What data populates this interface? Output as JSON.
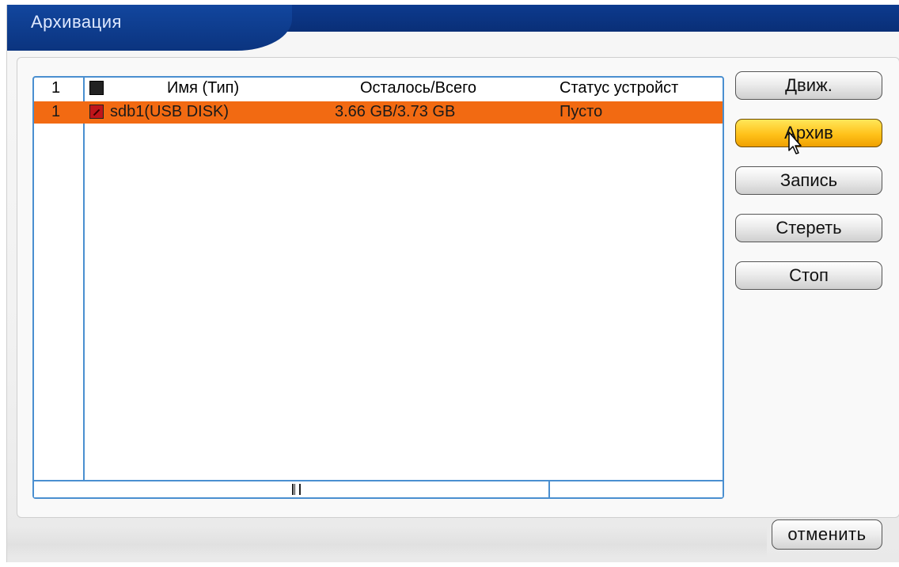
{
  "window": {
    "title": "Архивация"
  },
  "table": {
    "header": {
      "num": "1",
      "name": "Имя (Тип)",
      "size": "Осталось/Всего",
      "status": "Статус устройст"
    },
    "rows": [
      {
        "num": "1",
        "name": "sdb1(USB DISK)",
        "size": "3.66 GB/3.73 GB",
        "status": "Пусто",
        "selected": true
      }
    ]
  },
  "buttons": {
    "detect": "Движ.",
    "archive": "Архив",
    "record": "Запись",
    "erase": "Стереть",
    "stop": "Стоп",
    "cancel": "отменить"
  },
  "colors": {
    "title_bar": "#0b347f",
    "selected_row": "#f26a12",
    "table_border": "#4a8fd0",
    "active_button": "#ffc21a"
  }
}
